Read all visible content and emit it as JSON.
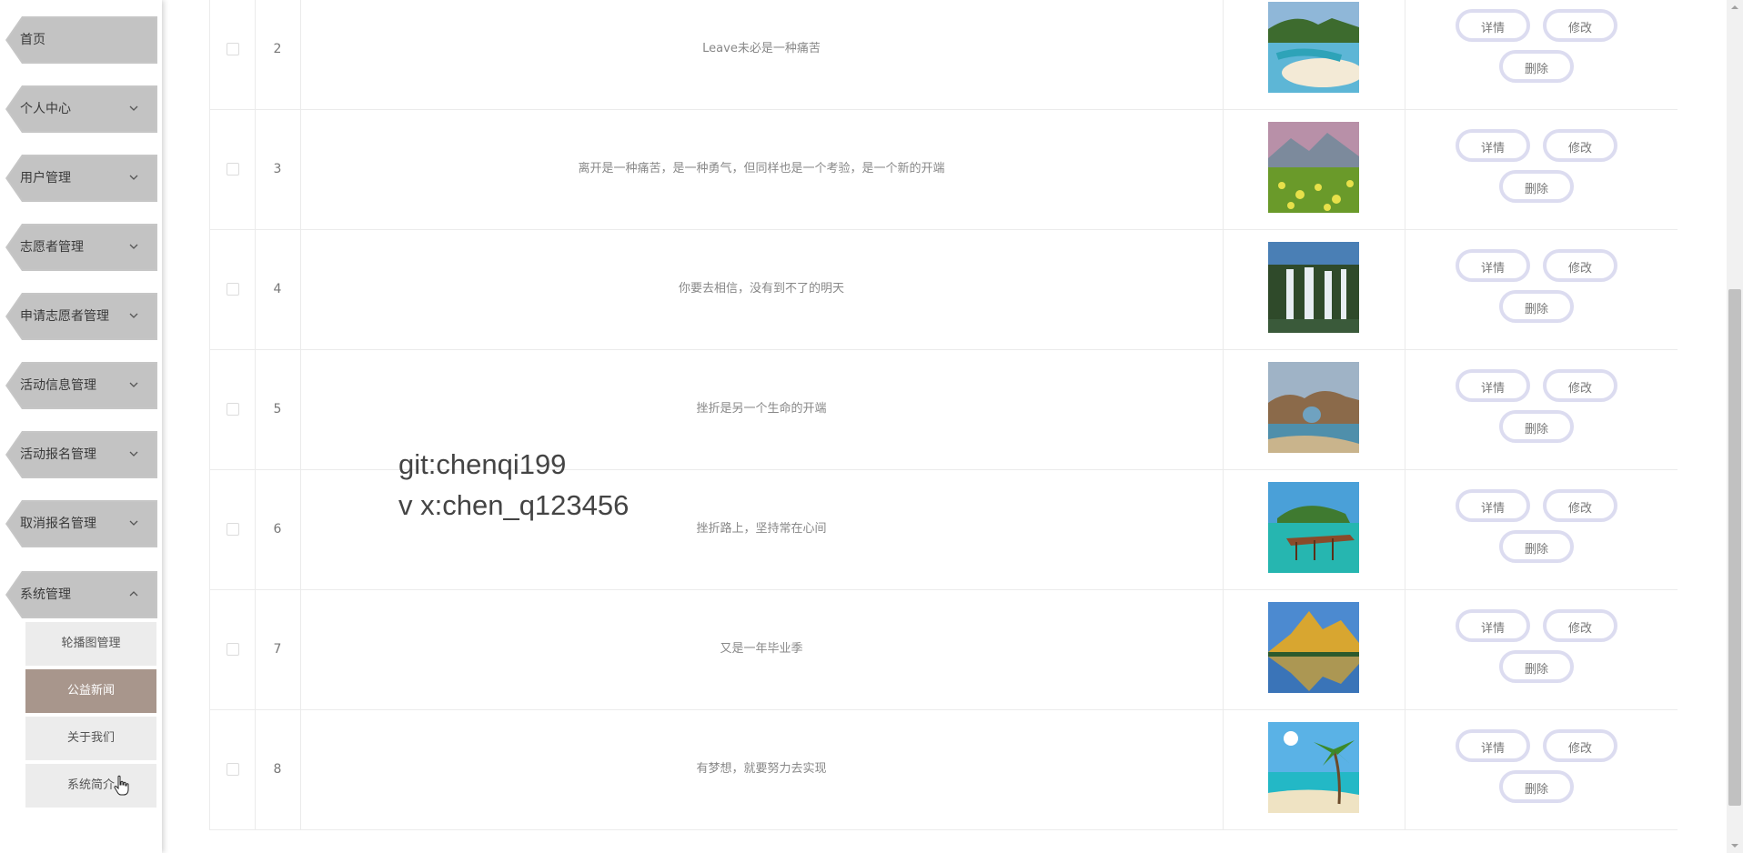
{
  "sidebar": {
    "items": [
      {
        "label": "首页",
        "has_arrow": false
      },
      {
        "label": "个人中心",
        "has_arrow": true
      },
      {
        "label": "用户管理",
        "has_arrow": true
      },
      {
        "label": "志愿者管理",
        "has_arrow": true
      },
      {
        "label": "申请志愿者管理",
        "has_arrow": true
      },
      {
        "label": "活动信息管理",
        "has_arrow": true
      },
      {
        "label": "活动报名管理",
        "has_arrow": true
      },
      {
        "label": "取消报名管理",
        "has_arrow": true
      },
      {
        "label": "系统管理",
        "has_arrow": true,
        "expanded": true
      }
    ],
    "sub_items": [
      {
        "label": "轮播图管理",
        "active": false
      },
      {
        "label": "公益新闻",
        "active": true
      },
      {
        "label": "关于我们",
        "active": false
      },
      {
        "label": "系统简介",
        "active": false
      }
    ]
  },
  "table": {
    "rows": [
      {
        "index": "2",
        "title": "Leave未必是一种痛苦",
        "image": "beach-lagoon"
      },
      {
        "index": "3",
        "title": "离开是一种痛苦，是一种勇气，但同样也是一个考验，是一个新的开端",
        "image": "flower-meadow"
      },
      {
        "index": "4",
        "title": "你要去相信，没有到不了的明天",
        "image": "waterfall"
      },
      {
        "index": "5",
        "title": "挫折是另一个生命的开端",
        "image": "rock-arch"
      },
      {
        "index": "6",
        "title": "挫折路上，坚持常在心间",
        "image": "pier-island"
      },
      {
        "index": "7",
        "title": "又是一年毕业季",
        "image": "mountain-lake"
      },
      {
        "index": "8",
        "title": "有梦想，就要努力去实现",
        "image": "palm-beach"
      }
    ],
    "actions": {
      "detail": "详情",
      "edit": "修改",
      "delete": "删除"
    }
  },
  "watermark": {
    "line1": "git:chenqi199",
    "line2": "v x:chen_q123456"
  },
  "colors": {
    "active_sub_bg": "#a8968c",
    "menu_bg": "#c3c3c3",
    "button_border": "#dcdcf0"
  }
}
